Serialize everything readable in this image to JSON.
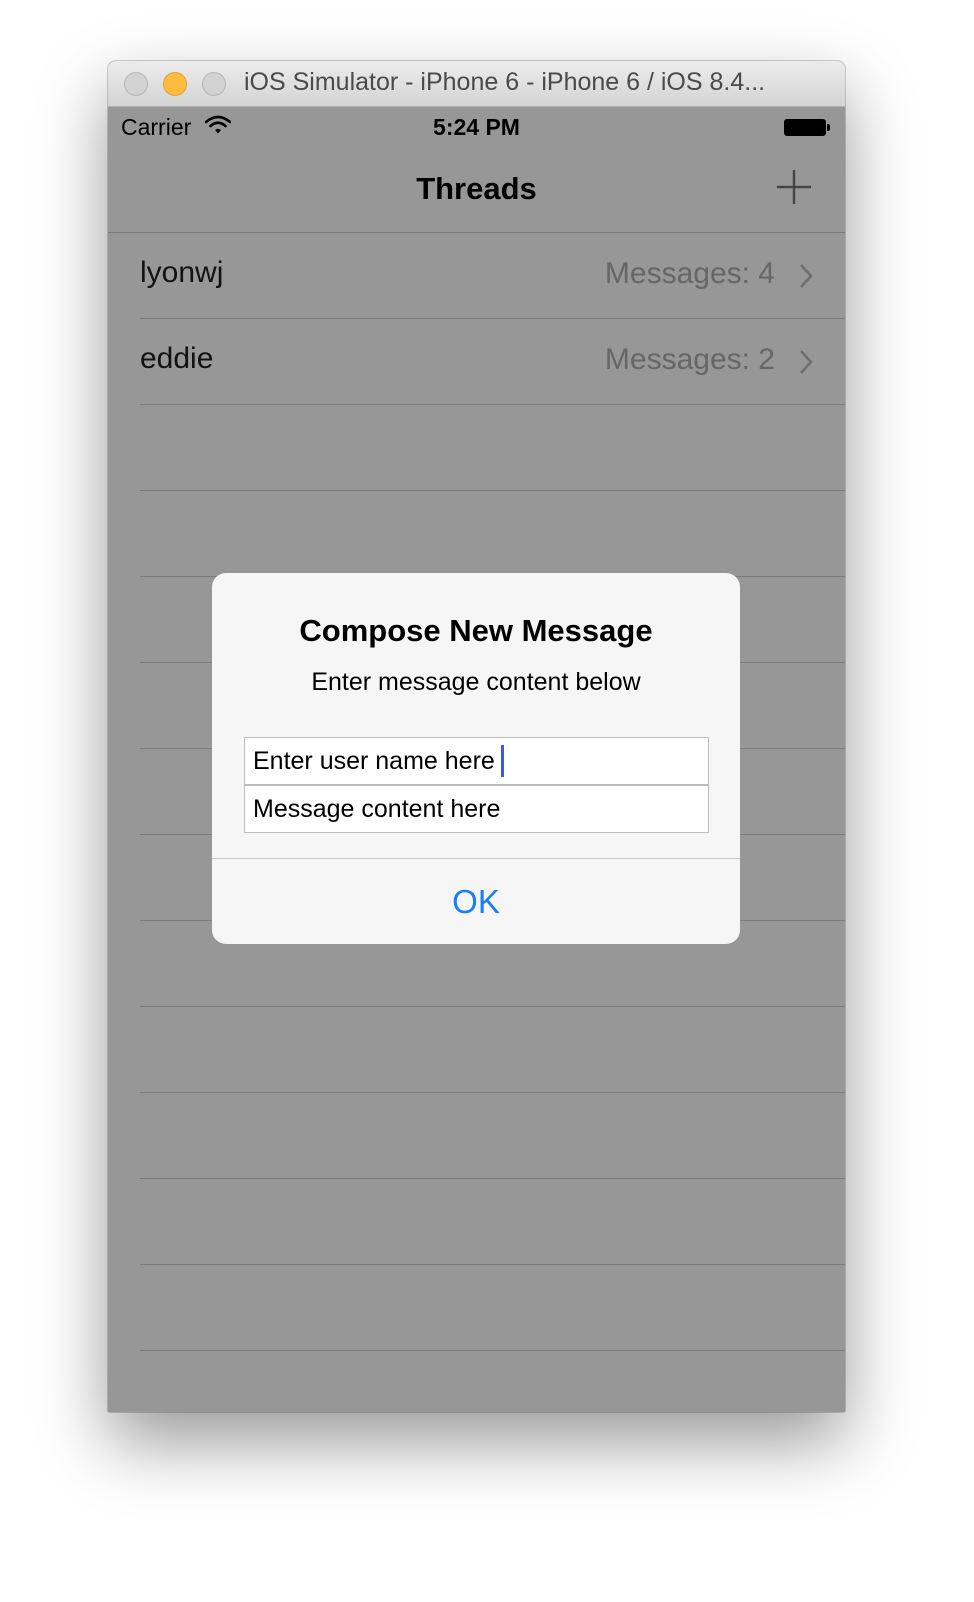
{
  "window": {
    "title": "iOS Simulator - iPhone 6 - iPhone 6 / iOS 8.4..."
  },
  "status_bar": {
    "carrier": "Carrier",
    "time": "5:24 PM"
  },
  "nav_bar": {
    "title": "Threads",
    "add_icon": "plus-icon"
  },
  "threads": [
    {
      "name": "lyonwj",
      "detail": "Messages: 4"
    },
    {
      "name": "eddie",
      "detail": "Messages: 2"
    }
  ],
  "alert": {
    "title": "Compose New Message",
    "message": "Enter message content below",
    "user_field": {
      "value": "Enter user name here",
      "placeholder": ""
    },
    "message_field": {
      "value": "",
      "placeholder": "Message content here"
    },
    "ok_label": "OK"
  },
  "colors": {
    "dimmed_background": "#979797",
    "accent_blue": "#1a7dfa",
    "traffic_yellow": "#fdbc40"
  }
}
